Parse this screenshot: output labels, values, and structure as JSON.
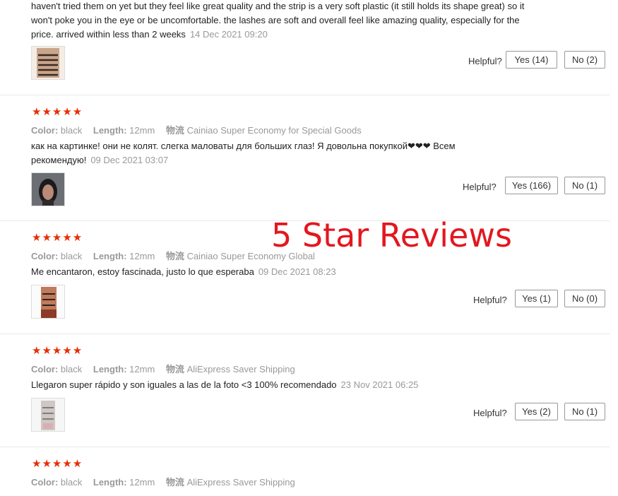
{
  "overlay_title": "5 Star Reviews",
  "colors": {
    "star": "#e62e04",
    "overlay": "#e3171f",
    "meta": "#999999"
  },
  "labels": {
    "color": "Color:",
    "length": "Length:",
    "shipping": "物流",
    "helpful": "Helpful?"
  },
  "reviews": [
    {
      "text": "haven't tried them on yet but they feel like great quality and the strip is a very soft plastic (it still holds its shape great) so it won't poke you in the eye or be uncomfortable. the lashes are soft and overall feel like amazing quality, especially for the price. arrived within less than 2 weeks",
      "date": "14 Dec 2021 09:20",
      "yes": "Yes (14)",
      "no": "No (2)"
    },
    {
      "stars": "★★★★★",
      "color": "black",
      "length": "12mm",
      "shipping": "Cainiao Super Economy for Special Goods",
      "text": "как на картинке! они не колят. слегка маловаты для больших глаз! Я довольна покупкой❤❤❤ Всем рекомендую!",
      "date": "09 Dec 2021 03:07",
      "yes": "Yes (166)",
      "no": "No (1)"
    },
    {
      "stars": "★★★★★",
      "color": "black",
      "length": "12mm",
      "shipping": "Cainiao Super Economy Global",
      "text": "Me encantaron, estoy fascinada, justo lo que esperaba",
      "date": "09 Dec 2021 08:23",
      "yes": "Yes (1)",
      "no": "No (0)"
    },
    {
      "stars": "★★★★★",
      "color": "black",
      "length": "12mm",
      "shipping": "AliExpress Saver Shipping",
      "text": "Llegaron super rápido y son iguales a las de la foto <3 100% recomendado",
      "date": "23 Nov 2021 06:25",
      "yes": "Yes (2)",
      "no": "No (1)"
    },
    {
      "stars": "★★★★★",
      "color": "black",
      "length": "12mm",
      "shipping": "AliExpress Saver Shipping"
    }
  ]
}
